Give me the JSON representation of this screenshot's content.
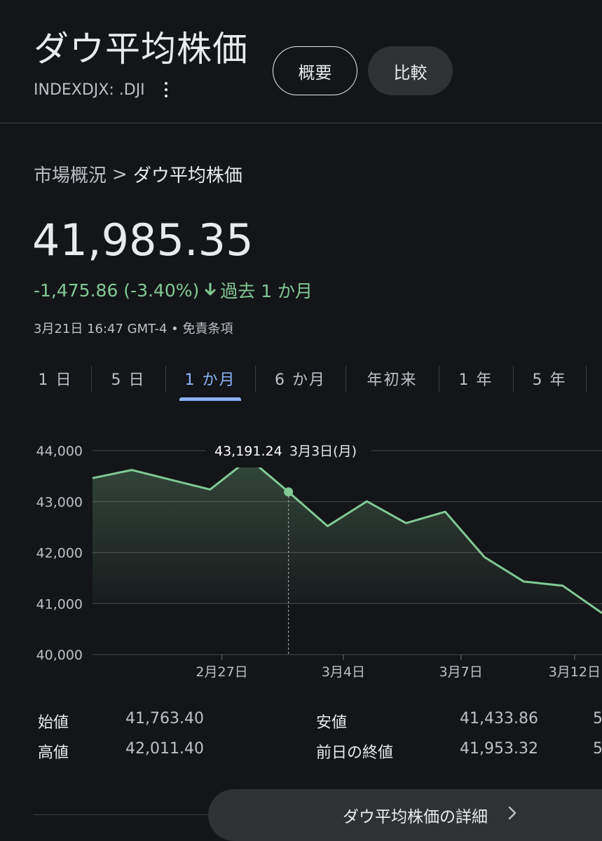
{
  "header": {
    "title": "ダウ平均株価",
    "ticker": "INDEXDJX: .DJI",
    "overview_label": "概要",
    "compare_label": "比較"
  },
  "breadcrumb": {
    "parent": "市場概況",
    "separator": ">",
    "current": "ダウ平均株価"
  },
  "quote": {
    "price": "41,985.35",
    "change": "-1,475.86 (-3.40%)",
    "period": "過去 1 か月",
    "timestamp": "3月21日 16:47 GMT-4 • 免責条項"
  },
  "tabs": [
    "1 日",
    "5 日",
    "1 か月",
    "6 か月",
    "年初来",
    "1 年",
    "5 年"
  ],
  "active_tab": 2,
  "chart_data": {
    "type": "area",
    "y_ticks": [
      40000,
      41000,
      42000,
      43000,
      44000
    ],
    "y_tick_labels": [
      "40,000",
      "41,000",
      "42,000",
      "43,000",
      "44,000"
    ],
    "ylim": [
      40000,
      44000
    ],
    "x_tick_labels": [
      "2月27日",
      "3月4日",
      "3月7日",
      "3月12日"
    ],
    "x_tick_index": [
      3.3,
      6.4,
      9.4,
      12.3
    ],
    "values": [
      43461,
      43621,
      43428,
      43239,
      43840,
      43191,
      42520,
      43006,
      42579,
      42802,
      41912,
      41433,
      41350,
      40814
    ],
    "tooltip": {
      "value": "43,191.24",
      "date": "3月3日(月)",
      "index": 5
    },
    "colors": {
      "line": "#81c995",
      "grid": "#3c4043",
      "hover": "#9aa0a6"
    }
  },
  "stats": {
    "open_label": "始値",
    "open": "41,763.40",
    "high_label": "高値",
    "high": "42,011.40",
    "low_label": "安値",
    "low": "41,433.86",
    "prev_close_label": "前日の終値",
    "prev_close": "41,953.32",
    "cut_1": "5",
    "cut_2": "5"
  },
  "more_button": {
    "label": "ダウ平均株価の詳細",
    "icon": "chevron-right-icon"
  }
}
